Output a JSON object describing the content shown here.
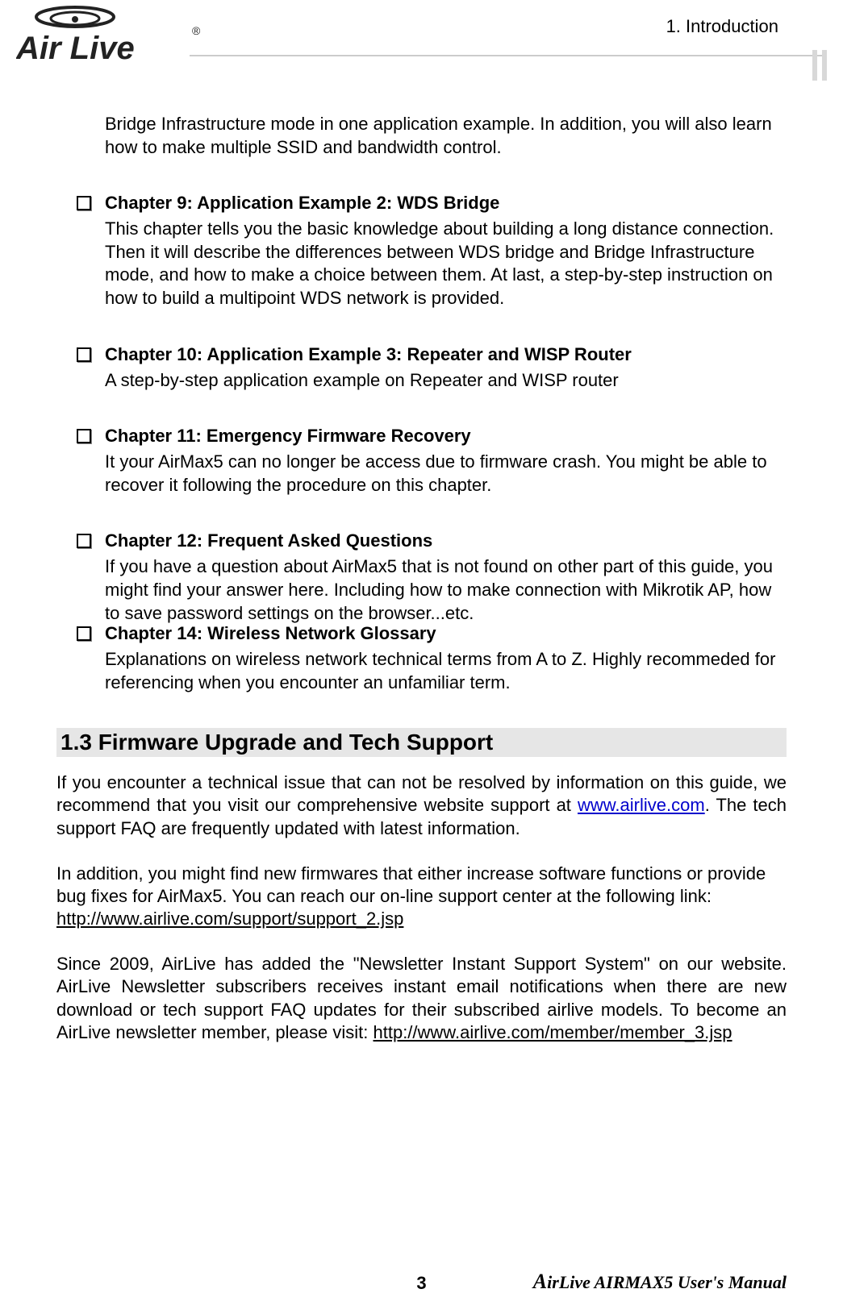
{
  "header": {
    "section_label": "1. Introduction",
    "logo_text_main": "Air Live",
    "logo_reg": "®"
  },
  "intro_paragraph": "Bridge Infrastructure mode in one application example.    In addition, you will also learn how to make multiple SSID and bandwidth control.",
  "chapters": [
    {
      "title": "Chapter 9: Application Example 2: WDS Bridge",
      "desc": "This chapter tells you the basic knowledge about building a long distance connection. Then it will describe the differences between WDS bridge and Bridge Infrastructure mode, and how to make a choice between them.    At last, a step-by-step instruction on how to build a multipoint WDS network is provided."
    },
    {
      "title": "Chapter 10: Application Example 3: Repeater and WISP Router",
      "desc": "A step-by-step application example on Repeater and WISP router"
    },
    {
      "title": "Chapter 11: Emergency Firmware Recovery",
      "desc": "It your AirMax5 can no longer be access due to firmware crash.    You might be able to recover it following the procedure on this chapter."
    },
    {
      "title": "Chapter 12: Frequent Asked Questions",
      "desc": "If you have a question about AirMax5 that is not found on other part of this guide, you might find your answer here.    Including how to make connection with Mikrotik AP, how to save password settings on the browser...etc."
    },
    {
      "title": "Chapter 14: Wireless Network Glossary",
      "desc": "Explanations on wireless network technical terms from A to Z.    Highly recommeded for referencing when you encounter an unfamiliar term."
    }
  ],
  "trailing_dot": ".",
  "section": {
    "heading": "1.3 Firmware  Upgrade  and  Tech  Support",
    "para1_a": "If you encounter a technical issue that can not be resolved by information on this guide, we recommend that you visit our comprehensive website support at ",
    "para1_link": "www.airlive.com",
    "para1_b": ".   The tech support FAQ are frequently updated with latest information.",
    "para2_a": "In addition, you might find new firmwares that either increase software functions or provide bug fixes for AirMax5.    You can reach our on-line support center at the following link: ",
    "para2_link": "http://www.airlive.com/support/support_2.jsp",
    "para3_a": "Since 2009, AirLive has added the \"Newsletter Instant Support System\" on our website. AirLive Newsletter subscribers receives instant email notifications when there are new download or tech support FAQ updates for their subscribed airlive models.    To become an AirLive newsletter member, please visit: ",
    "para3_link": "http://www.airlive.com/member/member_3.jsp"
  },
  "footer": {
    "page_number": "3",
    "manual_a": "A",
    "manual_rest": "irLive  AIRMAX5  User's  Manual"
  }
}
